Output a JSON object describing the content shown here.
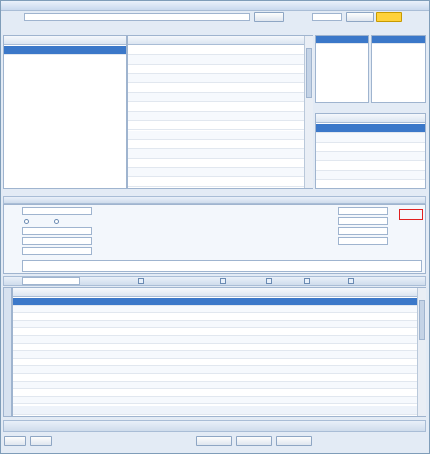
{
  "window": {
    "title": ""
  },
  "top": {
    "file_label": "",
    "file_path": "",
    "open_file": "",
    "select_sheet_label": "",
    "sheet_value": "",
    "validate_btn": "",
    "generate_btn": ""
  },
  "import_grid": {
    "caption": "",
    "headers": [
      "",
      "",
      "",
      "",
      "",
      "",
      ""
    ]
  },
  "product_grid": {
    "headers": [
      "",
      "",
      "",
      "",
      "",
      "",
      ""
    ],
    "rows": [
      [
        "",
        "",
        "",
        "",
        "",
        ""
      ],
      [
        "",
        "",
        "",
        "",
        "",
        ""
      ],
      [
        "",
        "",
        "",
        "",
        "",
        ""
      ],
      [
        "",
        "",
        "",
        "",
        "",
        ""
      ],
      [
        "",
        "",
        "",
        "",
        "",
        ""
      ],
      [
        "",
        "",
        "",
        "",
        "",
        ""
      ],
      [
        "",
        "",
        "",
        "",
        "",
        ""
      ],
      [
        "",
        "",
        "",
        "",
        "",
        ""
      ],
      [
        "",
        "",
        "",
        "",
        "",
        ""
      ],
      [
        "",
        "",
        "",
        "",
        "",
        ""
      ],
      [
        "",
        "",
        "",
        "",
        "",
        ""
      ],
      [
        "",
        "",
        "",
        "",
        "",
        ""
      ],
      [
        "",
        "",
        "",
        "",
        "",
        ""
      ],
      [
        "",
        "",
        "",
        "",
        "",
        ""
      ],
      [
        "",
        "",
        "",
        "",
        "",
        ""
      ]
    ]
  },
  "required_fields": {
    "caption": "",
    "items": [
      "",
      "",
      "",
      "",
      ""
    ]
  },
  "missing_fields": {
    "caption": "",
    "items": [
      "",
      "",
      ""
    ]
  },
  "mapping": {
    "caption": "",
    "headers": [
      "",
      ""
    ],
    "rows": [
      [
        "",
        ""
      ],
      [
        "",
        ""
      ],
      [
        "",
        ""
      ],
      [
        "",
        ""
      ],
      [
        "",
        ""
      ],
      [
        "",
        ""
      ]
    ]
  },
  "form": {
    "tab": "",
    "title": "",
    "stamp": "",
    "supplier_label": "",
    "supplier_value": "",
    "store_label": "",
    "radio1": "",
    "radio2": "",
    "warehouse_label": "",
    "warehouse_value": "",
    "buyer_label": "",
    "buyer_value": "",
    "contact_label": "",
    "remark_label": "",
    "doc_no_label": "",
    "doc_no_value": "",
    "biz_date_label": "",
    "biz_date_value": "",
    "audit_date_label": "",
    "audit_date_value": "",
    "doc_status_label": "",
    "doc_status_value": "",
    "attach_label": ""
  },
  "toolbar2": {
    "barcode_label": "",
    "count_label": "",
    "btn1": "",
    "btn2": "",
    "btn3": "",
    "btn4": "",
    "btn5": "",
    "btn6": ""
  },
  "detail_grid": {
    "side_tab": "",
    "headers": [
      "",
      "",
      "",
      "",
      "",
      "",
      "",
      "",
      "",
      "",
      "",
      "",
      "",
      "",
      "",
      "",
      ""
    ],
    "rows": [
      [
        "",
        "",
        "",
        "",
        "",
        "",
        "",
        "",
        "",
        "",
        ""
      ],
      [
        "",
        "",
        "",
        "",
        "",
        "",
        "",
        "",
        "",
        "",
        ""
      ],
      [
        "",
        "",
        "",
        "",
        "",
        "",
        "",
        "",
        "",
        "",
        ""
      ],
      [
        "",
        "",
        "",
        "",
        "",
        "",
        "",
        "",
        "",
        "",
        ""
      ],
      [
        "",
        "",
        "",
        "",
        "",
        "",
        "",
        "",
        "",
        "",
        ""
      ],
      [
        "",
        "",
        "",
        "",
        "",
        "",
        "",
        "",
        "",
        "",
        ""
      ],
      [
        "",
        "",
        "",
        "",
        "",
        "",
        "",
        "",
        "",
        "",
        ""
      ],
      [
        "",
        "",
        "",
        "",
        "",
        "",
        "",
        "",
        "",
        "",
        ""
      ],
      [
        "",
        "",
        "",
        "",
        "",
        "",
        "",
        "",
        "",
        "",
        ""
      ],
      [
        "",
        "",
        "",
        "",
        "",
        "",
        "",
        "",
        "",
        "",
        ""
      ],
      [
        "",
        "",
        "",
        "",
        "",
        "",
        "",
        "",
        "",
        "",
        ""
      ],
      [
        "",
        "",
        "",
        "",
        "",
        "",
        "",
        "",
        "",
        "",
        ""
      ],
      [
        "",
        "",
        "",
        "",
        "",
        "",
        "",
        "",
        "",
        "",
        ""
      ],
      [
        "",
        "",
        "",
        "",
        "",
        "",
        "",
        "",
        "",
        "",
        ""
      ]
    ],
    "total_label": ""
  },
  "footer": {
    "maker_label": "",
    "maker_value": "",
    "auditor_label": "",
    "auditor_value": "",
    "print_label": "",
    "total_amount_label": "",
    "total_amount_value": "",
    "total_amount_label2": "",
    "total_amount_value2": "",
    "total_qty_label": "",
    "total_qty_value": "",
    "confirm_btn": "",
    "cancel_btn": "",
    "import_btn": "",
    "batch_import_btn": "",
    "batch_validate_btn": ""
  }
}
